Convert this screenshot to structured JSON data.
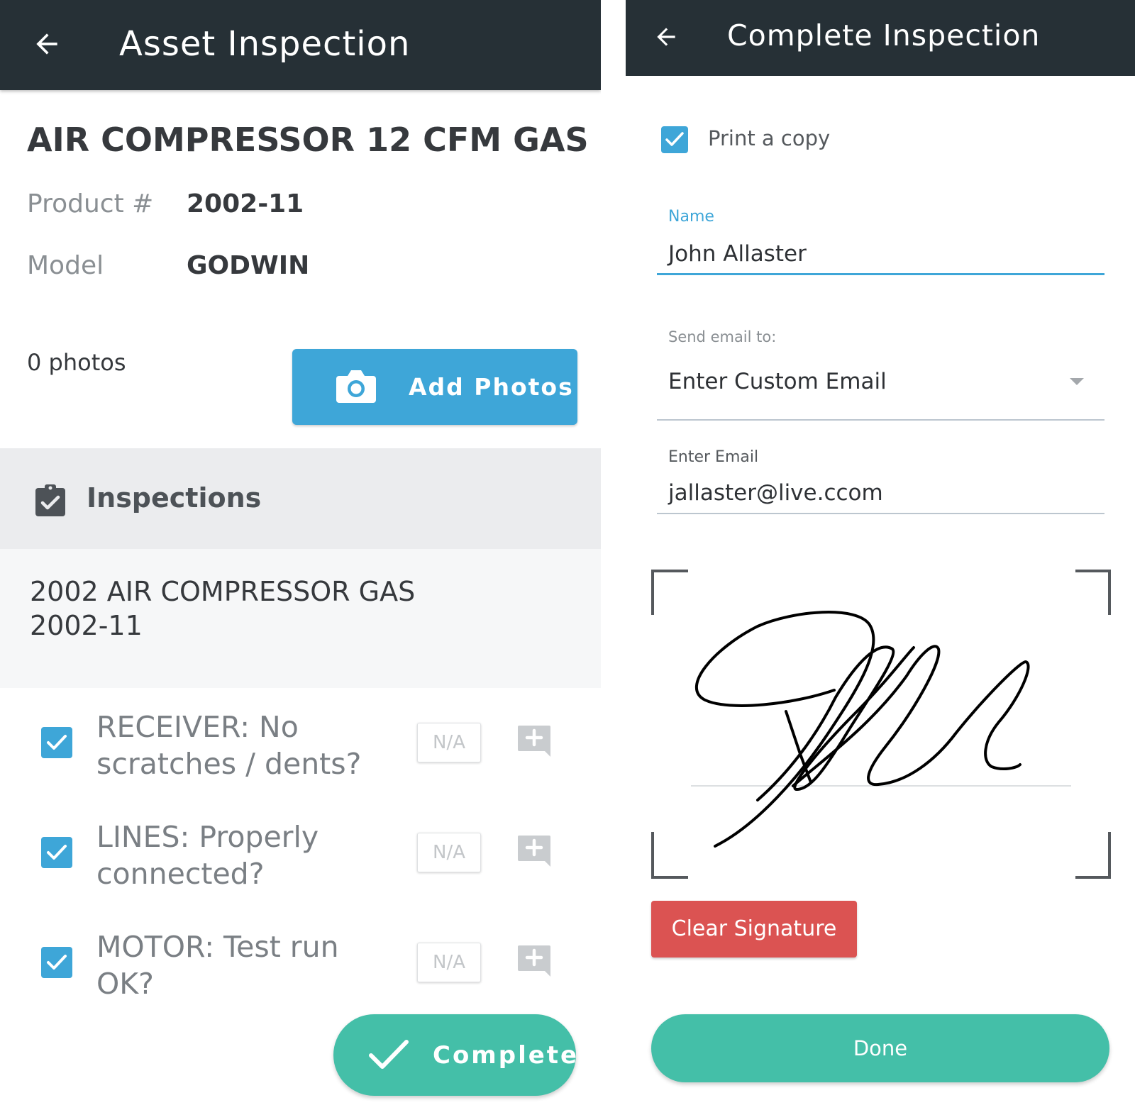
{
  "left_screen": {
    "app_bar": {
      "title": "Asset Inspection",
      "back_icon": "arrow-left-icon"
    },
    "asset": {
      "name": "AIR COMPRESSOR 12 CFM GAS",
      "product_label": "Product #",
      "product_value": "2002-11",
      "model_label": "Model",
      "model_value": "GODWIN"
    },
    "photos": {
      "count_text": "0 photos",
      "add_button_label": "Add Photos",
      "icon": "camera-icon"
    },
    "inspections": {
      "section_title": "Inspections",
      "icon": "clipboard-check-icon",
      "group_line1": "2002 AIR COMPRESSOR GAS",
      "group_line2": "2002-11",
      "items": [
        {
          "label": "RECEIVER: No scratches / dents?",
          "checked": true,
          "na_label": "N/A"
        },
        {
          "label": "LINES: Properly connected?",
          "checked": true,
          "na_label": "N/A"
        },
        {
          "label": "MOTOR: Test run OK?",
          "checked": true,
          "na_label": "N/A"
        }
      ]
    },
    "complete_button_label": "Complete"
  },
  "right_screen": {
    "app_bar": {
      "title": "Complete Inspection",
      "back_icon": "arrow-left-icon"
    },
    "print_copy": {
      "label": "Print a copy",
      "checked": true
    },
    "name_field": {
      "label": "Name",
      "value": "John Allaster"
    },
    "send_email": {
      "label": "Send email to:",
      "selected": "Enter Custom Email"
    },
    "email_field": {
      "label": "Enter Email",
      "value": "jallaster@live.ccom"
    },
    "clear_signature_label": "Clear Signature",
    "done_label": "Done"
  },
  "colors": {
    "app_bar": "#263036",
    "primary_blue": "#3ea6d8",
    "teal": "#44bfa8",
    "danger_red": "#db5352",
    "section_gray": "#ebecee"
  }
}
